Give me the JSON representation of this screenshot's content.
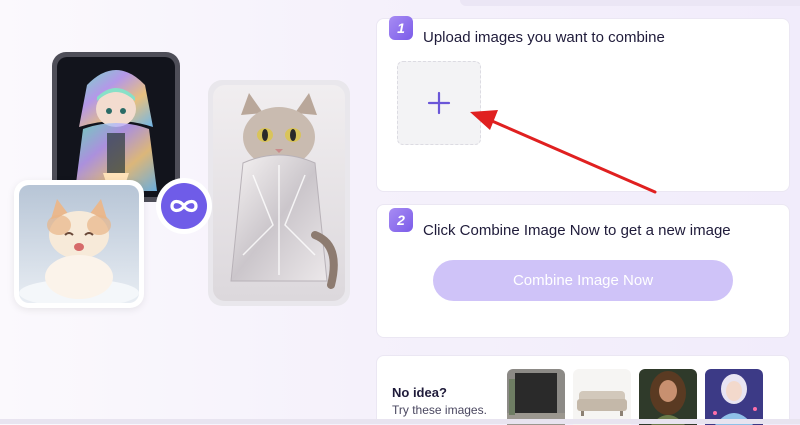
{
  "step1": {
    "number": "1",
    "title": "Upload images you want to combine"
  },
  "step2": {
    "number": "2",
    "title": "Click Combine Image Now to get a new image",
    "button_label": "Combine Image Now"
  },
  "samples": {
    "title": "No idea?",
    "subtitle": "Try these images.",
    "thumbnails": [
      "black-wall-room",
      "beige-sofa",
      "curly-hair-woman",
      "ice-princess"
    ]
  },
  "icons": {
    "upload": "plus-icon",
    "merge": "infinity-icon",
    "annotation": "red-arrow-icon"
  },
  "colors": {
    "accent": "#6f5ce8",
    "button_disabled": "#cfc3f8",
    "arrow": "#e02020"
  }
}
